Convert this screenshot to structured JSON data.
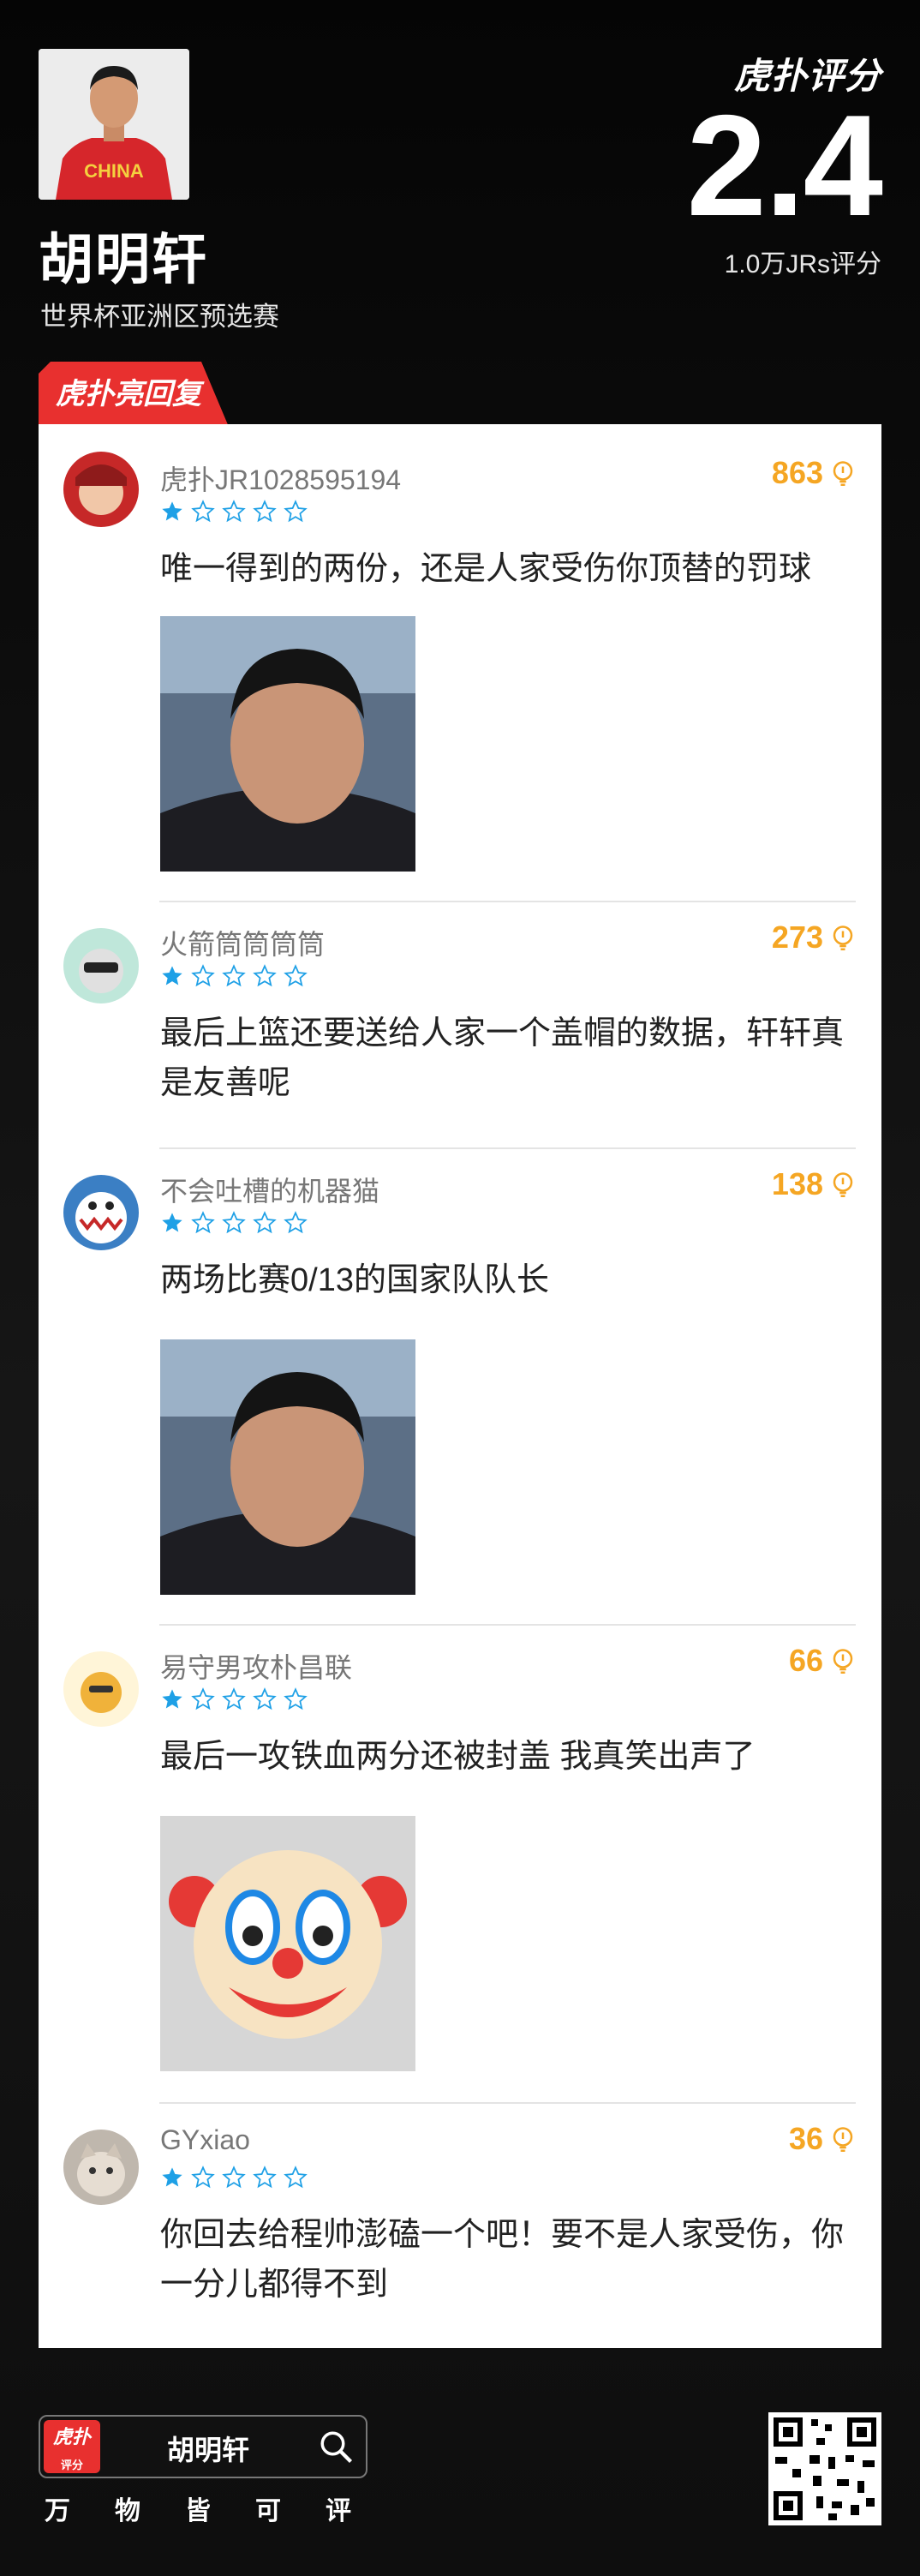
{
  "header": {
    "player_name": "胡明轩",
    "match": "世界杯亚洲区预选赛",
    "brand": "虎扑评分",
    "score": "2.4",
    "rating_count": "1.0万JRs评分",
    "jersey_text": "CHINA"
  },
  "section_tag": "虎扑亮回复",
  "comments": [
    {
      "user": "虎扑JR1028595194",
      "likes": "863",
      "rating": 1,
      "text": "唯一得到的两份，还是人家受伤你顶替的罚球"
    },
    {
      "user": "火箭筒筒筒筒",
      "likes": "273",
      "rating": 1,
      "text": "最后上篮还要送给人家一个盖帽的数据，轩轩真是友善呢"
    },
    {
      "user": "不会吐槽的机器猫",
      "likes": "138",
      "rating": 1,
      "text": "两场比赛0/13的国家队队长"
    },
    {
      "user": "易守男攻朴昌联",
      "likes": "66",
      "rating": 1,
      "text": "最后一攻铁血两分还被封盖 我真笑出声了"
    },
    {
      "user": "GYxiao",
      "likes": "36",
      "rating": 1,
      "text": "你回去给程帅澎磕一个吧！要不是人家受伤，你一分儿都得不到"
    }
  ],
  "footer": {
    "logo_top": "虎扑",
    "logo_bottom": "评分",
    "search_query": "胡明轩",
    "slogan": [
      "万",
      "物",
      "皆",
      "可",
      "评"
    ]
  },
  "colors": {
    "accent_red": "#e8302f",
    "likes_orange": "#f5a623",
    "star_blue": "#1ea0e6"
  }
}
